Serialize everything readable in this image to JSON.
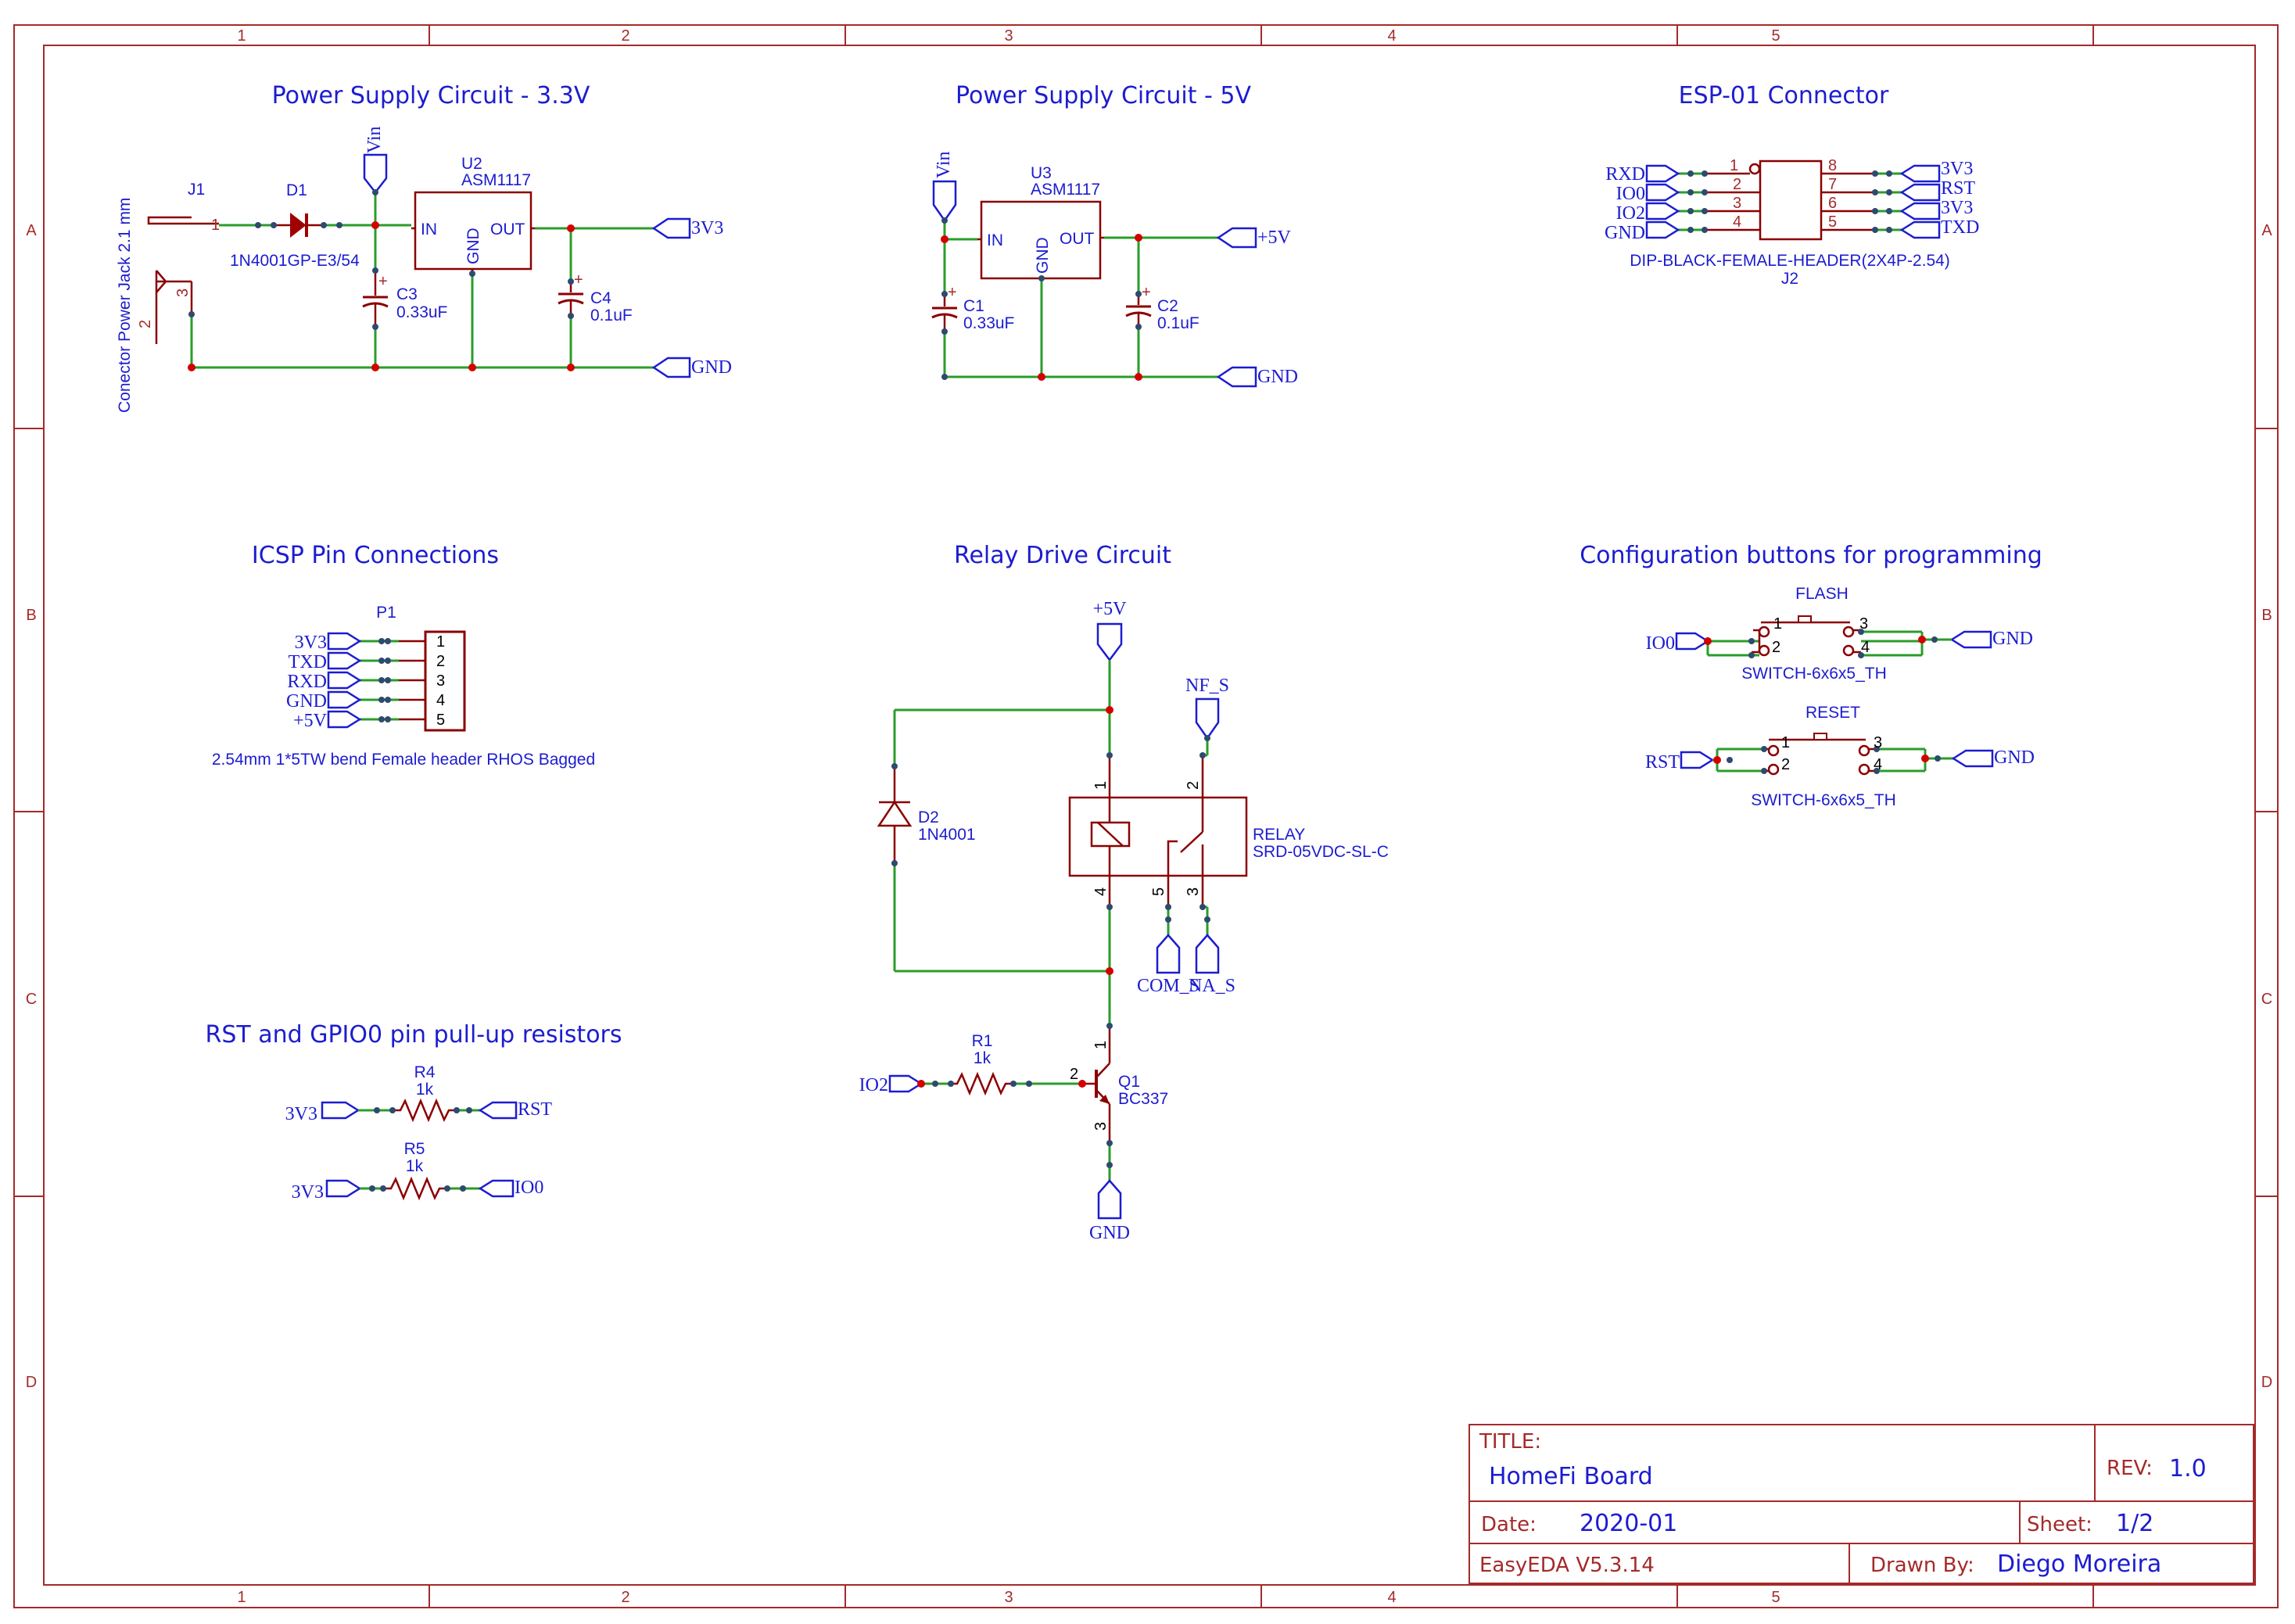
{
  "sheet": {
    "columns": [
      "1",
      "2",
      "3",
      "4",
      "5"
    ],
    "rows": [
      "A",
      "B",
      "C",
      "D"
    ]
  },
  "sections": {
    "power_33": "Power Supply Circuit - 3.3V",
    "power_5": "Power Supply Circuit - 5V",
    "esp01": "ESP-01 Connector",
    "icsp": "ICSP Pin Connections",
    "relay": "Relay Drive Circuit",
    "buttons": "Configuration buttons for programming",
    "pullups": "RST and GPIO0 pin pull-up resistors"
  },
  "power_33": {
    "j1_ref": "J1",
    "j1_desc": "Conector Power Jack 2.1 mm",
    "j1_pin1": "1",
    "j1_pin2": "2",
    "j1_pin3": "3",
    "d1_ref": "D1",
    "d1_value": "1N4001GP-E3/54",
    "vin_net": "Vin",
    "u2_ref": "U2",
    "u2_value": "ASM1117",
    "pin_in": "IN",
    "pin_gnd": "GND",
    "pin_out": "OUT",
    "c3_ref": "C3",
    "c3_value": "0.33uF",
    "c4_ref": "C4",
    "c4_value": "0.1uF",
    "out_net": "3V3",
    "gnd_net": "GND"
  },
  "power_5": {
    "vin_net": "Vin",
    "u3_ref": "U3",
    "u3_value": "ASM1117",
    "pin_in": "IN",
    "pin_gnd": "GND",
    "pin_out": "OUT",
    "c1_ref": "C1",
    "c1_value": "0.33uF",
    "c2_ref": "C2",
    "c2_value": "0.1uF",
    "out_net": "+5V",
    "gnd_net": "GND"
  },
  "esp01": {
    "left_nets": [
      "RXD",
      "IO0",
      "IO2",
      "GND"
    ],
    "left_pins": [
      "1",
      "2",
      "3",
      "4"
    ],
    "right_pins": [
      "8",
      "7",
      "6",
      "5"
    ],
    "right_nets": [
      "3V3",
      "RST",
      "3V3",
      "TXD"
    ],
    "value": "DIP-BLACK-FEMALE-HEADER(2X4P-2.54)",
    "ref": "J2"
  },
  "icsp": {
    "ref": "P1",
    "nets": [
      "3V3",
      "TXD",
      "RXD",
      "GND",
      "+5V"
    ],
    "pins": [
      "1",
      "2",
      "3",
      "4",
      "5"
    ],
    "value": "2.54mm 1*5TW bend Female header RHOS Bagged"
  },
  "relay": {
    "vcc_net": "+5V",
    "nf_net": "NF_S",
    "d2_ref": "D2",
    "d2_value": "1N4001",
    "relay_ref": "RELAY",
    "relay_value": "SRD-05VDC-SL-C",
    "pin1": "1",
    "pin2": "2",
    "pin3": "3",
    "pin4": "4",
    "pin5": "5",
    "com_net": "COM_S",
    "na_net": "NA_S",
    "r1_ref": "R1",
    "r1_value": "1k",
    "in_net": "IO2",
    "q1_ref": "Q1",
    "q1_value": "BC337",
    "q_pin1": "1",
    "q_pin2": "2",
    "q_pin3": "3",
    "gnd_net": "GND"
  },
  "buttons": {
    "flash_ref": "FLASH",
    "flash_value": "SWITCH-6x6x5_TH",
    "flash_left_net": "IO0",
    "flash_right_net": "GND",
    "reset_ref": "RESET",
    "reset_value": "SWITCH-6x6x5_TH",
    "reset_left_net": "RST",
    "reset_right_net": "GND",
    "pin1": "1",
    "pin2": "2",
    "pin3": "3",
    "pin4": "4"
  },
  "pullups": {
    "r4_ref": "R4",
    "r4_value": "1k",
    "r4_left_net": "3V3",
    "r4_right_net": "RST",
    "r5_ref": "R5",
    "r5_value": "1k",
    "r5_left_net": "3V3",
    "r5_right_net": "IO0"
  },
  "title_block": {
    "title_label": "TITLE:",
    "title": "HomeFi Board",
    "rev_label": "REV:",
    "rev": "1.0",
    "date_label": "Date:",
    "date": "2020-01",
    "sheet_label": "Sheet:",
    "sheet": "1/2",
    "tool": "EasyEDA V5.3.14",
    "drawn_label": "Drawn By:",
    "drawn_by": "Diego Moreira"
  }
}
